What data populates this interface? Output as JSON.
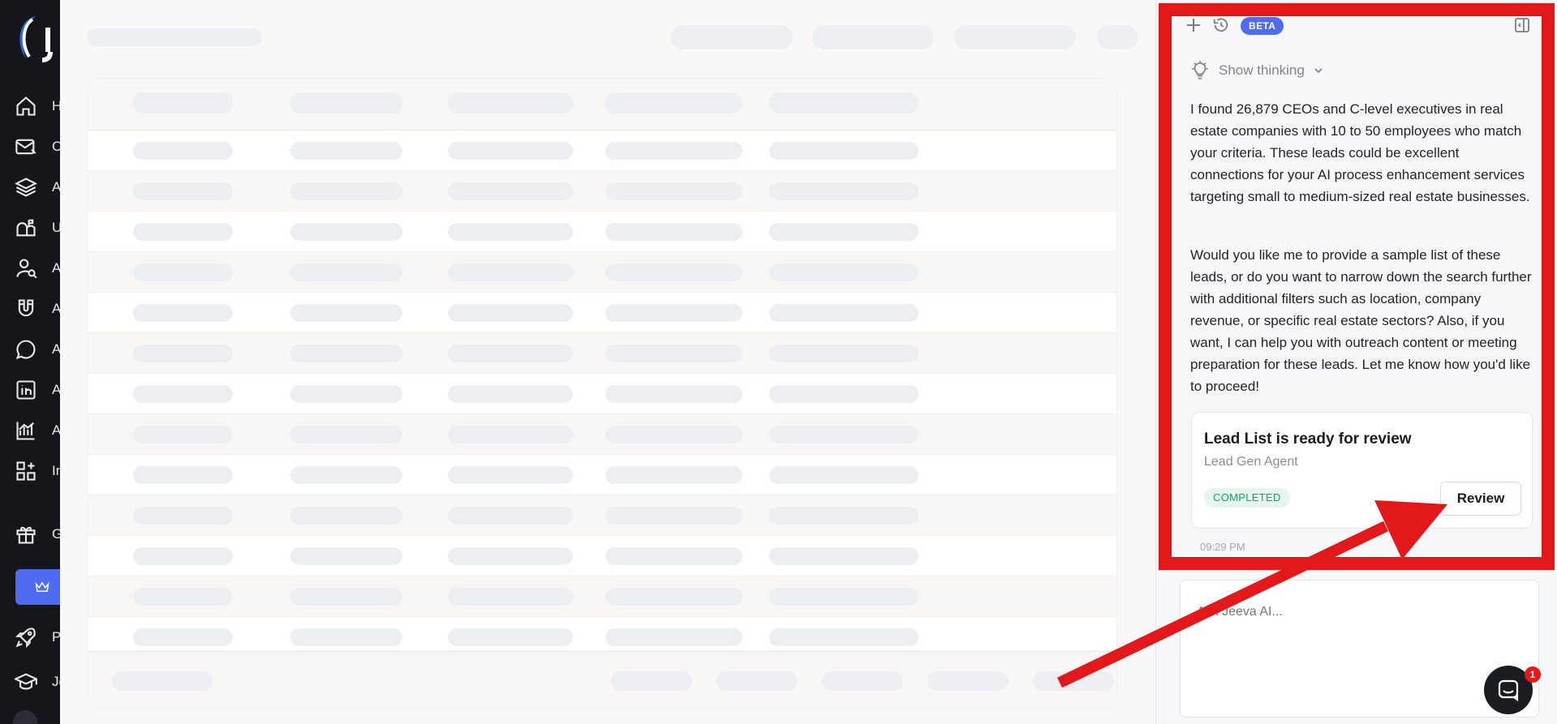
{
  "sidebar": {
    "items": [
      {
        "icon": "home-icon",
        "label": "H"
      },
      {
        "icon": "mail-icon",
        "label": "C"
      },
      {
        "icon": "layers-icon",
        "label": "A"
      },
      {
        "icon": "mailbox-icon",
        "label": "U"
      },
      {
        "icon": "user-search-icon",
        "label": "A"
      },
      {
        "icon": "magnet-icon",
        "label": "A"
      },
      {
        "icon": "chat-bubble-icon",
        "label": "A"
      },
      {
        "icon": "linkedin-icon",
        "label": "A"
      },
      {
        "icon": "chart-icon",
        "label": "A"
      },
      {
        "icon": "grid-plus-icon",
        "label": "In"
      },
      {
        "icon": "gift-icon",
        "label": "G"
      },
      {
        "icon": "rocket-icon",
        "label": "Po"
      },
      {
        "icon": "graduation-cap-icon",
        "label": "Je"
      }
    ],
    "upgrade_icon": "crown-icon"
  },
  "chat": {
    "beta_label": "BETA",
    "show_thinking_label": "Show thinking",
    "message_paragraph_1": "I found 26,879 CEOs and C-level executives in real estate companies with 10 to 50 employees who match your criteria. These leads could be excellent connections for your AI process enhancement services targeting small to medium-sized real estate businesses.",
    "message_paragraph_2": "Would you like me to provide a sample list of these leads, or do you want to narrow down the search further with additional filters such as location, company revenue, or specific real estate sectors? Also, if you want, I can help you with outreach content or meeting preparation for these leads. Let me know how you'd like to proceed!",
    "card": {
      "title": "Lead List is ready for review",
      "subtitle": "Lead Gen Agent",
      "status": "COMPLETED",
      "button_label": "Review"
    },
    "timestamp": "09:29 PM",
    "input_placeholder": "Ask Jeeva AI...",
    "notification_count": "1"
  },
  "colors": {
    "accent": "#4f6bf2",
    "annotation_red": "#e3181b",
    "sidebar_bg": "#14161b",
    "status_green": "#18a064"
  }
}
